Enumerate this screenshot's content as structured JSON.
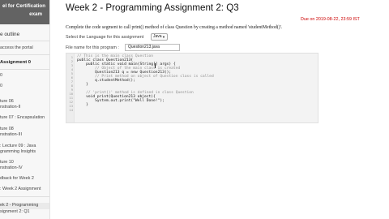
{
  "sidebar": {
    "header_line1": "el for Certification",
    "header_line2": "exam",
    "items": [
      {
        "label": "e outline"
      },
      {
        "label": "access the portal"
      },
      {
        "label": "Assignment 0"
      },
      {
        "label": "0"
      },
      {
        "label": "0"
      },
      {
        "label": "ture 06"
      },
      {
        "label": "nstration-II"
      },
      {
        "label": "ture 07 : Encapsulation"
      },
      {
        "label": "ture 08"
      },
      {
        "label": "nstration-III"
      },
      {
        "label": ": Lecture 09 : Java"
      },
      {
        "label": "gramming Insights"
      },
      {
        "label": "ture 10"
      },
      {
        "label": "nstration-IV"
      },
      {
        "label": "dback for Week 2"
      },
      {
        "label": ": Week 2 Assignment"
      },
      {
        "label": "ek 2 - Programming"
      },
      {
        "label": "signment 2: Q1"
      }
    ]
  },
  "main": {
    "title": "Week 2 - Programming Assignment 2: Q3",
    "due": "Due on 2019-08-22, 23:59 IST",
    "question": "Complete the code segment to call print() method of class Question by creating a method named 'studentMethod()'.",
    "language_label": "Select the Language for this assignment",
    "language_value": "Java",
    "filename_label": "File name for this program :",
    "filename_value": "Question213.java"
  },
  "editor": {
    "line_numbers": [
      "1",
      "2",
      "3",
      "4",
      "5",
      "6",
      "7",
      "8",
      "9",
      "10",
      "11",
      "12",
      "13",
      "14"
    ],
    "lines": [
      "// This is the main class Question",
      "public class Question213{",
      "    public static void main(String[] args) {",
      "        // Object of the main class is created",
      "        Question213 q = new Question213();",
      "        // Print method on object of Question class is called",
      "        q.studentMethod();",
      "    }",
      "",
      "    // 'print()' method is defined in class Question",
      "    void print(Question213 object){",
      "        System.out.print(\"Well Done!\");",
      "    }",
      ""
    ]
  }
}
